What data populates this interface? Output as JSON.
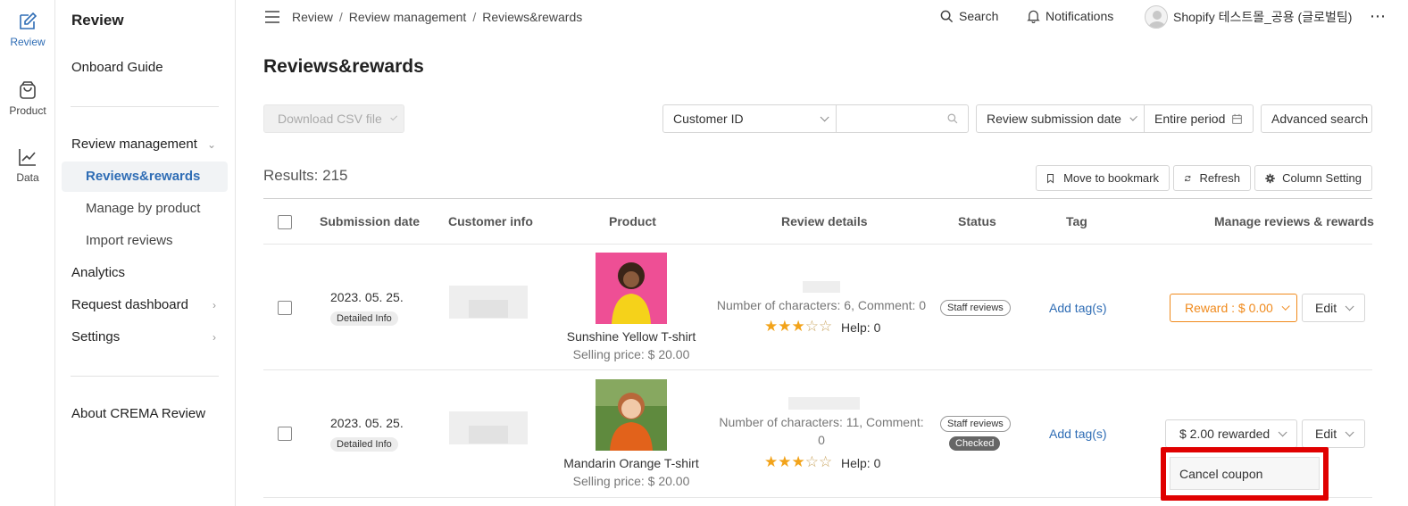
{
  "rail": [
    {
      "label": "Review",
      "icon": "edit-icon",
      "active": true
    },
    {
      "label": "Product",
      "icon": "shopping-bag-icon",
      "active": false
    },
    {
      "label": "Data",
      "icon": "chart-icon",
      "active": false
    }
  ],
  "sidebar": {
    "title": "Review",
    "onboard": "Onboard Guide",
    "review_management": "Review management",
    "sub": [
      "Reviews&rewards",
      "Manage by product",
      "Import reviews"
    ],
    "analytics": "Analytics",
    "request_dashboard": "Request dashboard",
    "settings": "Settings",
    "about": "About CREMA Review"
  },
  "topbar": {
    "breadcrumb": [
      "Review",
      "Review management",
      "Reviews&rewards"
    ],
    "search": "Search",
    "notifications": "Notifications",
    "account": "Shopify 테스트몰_공용 (글로벌팀)"
  },
  "page": {
    "title": "Reviews&rewards",
    "download_csv": "Download CSV file",
    "filter_field": "Customer ID",
    "search_value": "",
    "date_field": "Review submission date",
    "period": "Entire period",
    "advanced_search": "Advanced search",
    "results": "Results: 215",
    "move_bookmark": "Move to bookmark",
    "refresh": "Refresh",
    "column_setting": "Column Setting"
  },
  "table": {
    "headers": [
      "Submission date",
      "Customer info",
      "Product",
      "Review details",
      "Status",
      "Tag",
      "Manage reviews & rewards"
    ],
    "rows": [
      {
        "date": "2023. 05. 25.",
        "detail_badge": "Detailed Info",
        "product_name": "Sunshine Yellow T-shirt",
        "price": "Selling price: $ 20.00",
        "review_meta": "Number of characters: 6, Comment: 0",
        "rating": 3,
        "help": "Help: 0",
        "status": [
          "Staff reviews"
        ],
        "tag": "Add tag(s)",
        "reward": "Reward : $ 0.00",
        "edit": "Edit"
      },
      {
        "date": "2023. 05. 25.",
        "detail_badge": "Detailed Info",
        "product_name": "Mandarin Orange T-shirt",
        "price": "Selling price: $ 20.00",
        "review_meta_1": "Number of characters: 11, Comment:",
        "review_meta_2": "0",
        "rating": 3,
        "help": "Help: 0",
        "status": [
          "Staff reviews",
          "Checked"
        ],
        "tag": "Add tag(s)",
        "reward": "$ 2.00 rewarded",
        "edit": "Edit"
      }
    ]
  },
  "dropdown": {
    "item": "Cancel coupon"
  },
  "colors": {
    "accent": "#2f6db5",
    "reward_orange": "#f08a1c",
    "highlight": "#e00000",
    "star": "#f2a31a"
  }
}
